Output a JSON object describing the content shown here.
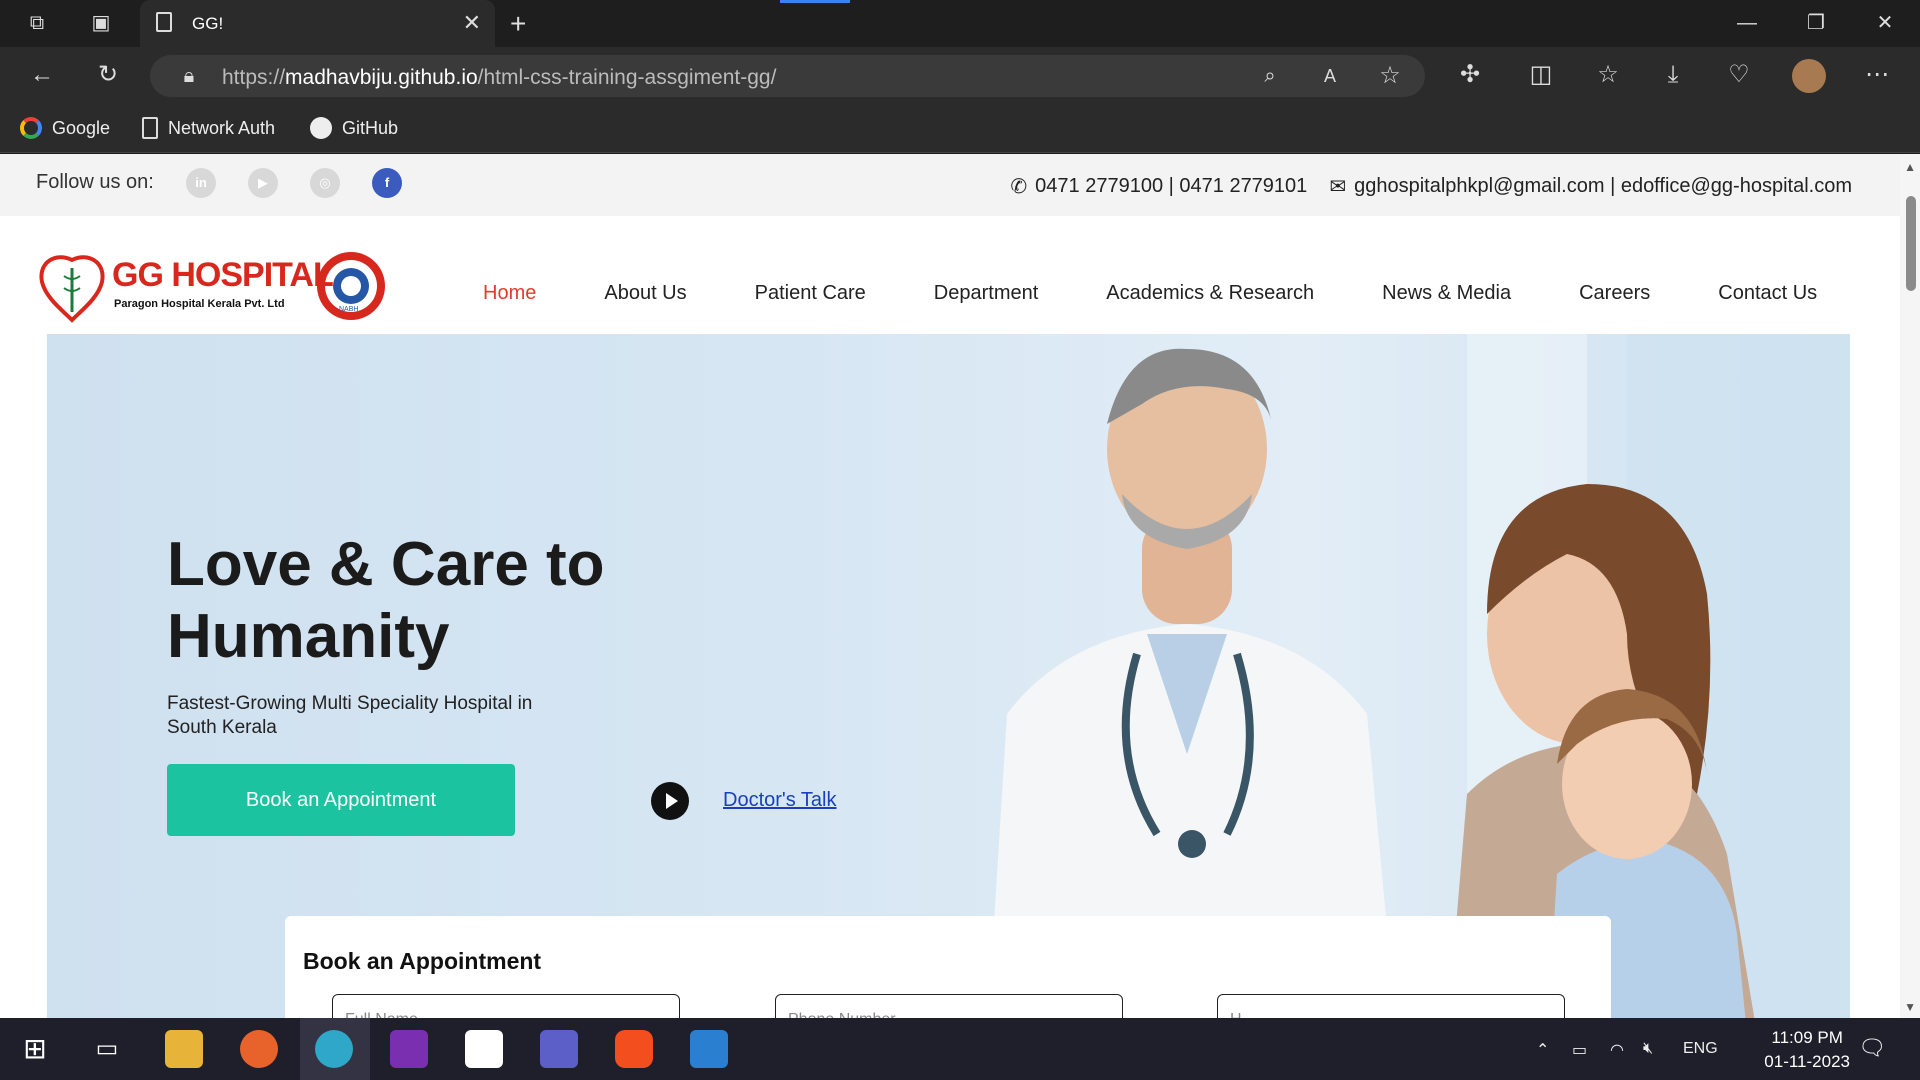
{
  "browser": {
    "tab_title": "GG!",
    "url_prefix": "https://",
    "url_host": "madhavbiju.github.io",
    "url_path": "/html-css-training-assgiment-gg/",
    "bookmarks": [
      {
        "label": "Google"
      },
      {
        "label": "Network Auth"
      },
      {
        "label": "GitHub"
      }
    ]
  },
  "topbar": {
    "follow_label": "Follow us on:",
    "social": [
      "in",
      "▶",
      "◎",
      "f"
    ],
    "phones": "0471 2779100 | 0471 2779101",
    "emails": "gghospitalphkpl@gmail.com | edoffice@gg-hospital.com"
  },
  "logo": {
    "name": "GG HOSPITAL",
    "tagline": "Paragon Hospital Kerala Pvt. Ltd",
    "badge": "NABH"
  },
  "nav": {
    "items": [
      {
        "label": "Home"
      },
      {
        "label": "About Us"
      },
      {
        "label": "Patient Care"
      },
      {
        "label": "Department"
      },
      {
        "label": "Academics & Research"
      },
      {
        "label": "News & Media"
      },
      {
        "label": "Careers"
      },
      {
        "label": "Contact Us"
      }
    ],
    "active_color": "#e23b2e"
  },
  "hero": {
    "title": "Love & Care to Humanity",
    "subtitle": "Fastest-Growing Multi Speciality Hospital in South Kerala",
    "cta": "Book an Appointment",
    "talk_link": "Doctor's Talk",
    "cta_color": "#1cc3a0"
  },
  "appointment": {
    "title": "Book an Appointment",
    "fields": [
      {
        "placeholder": "Full Name"
      },
      {
        "placeholder": "Phone Number"
      },
      {
        "placeholder": "H"
      }
    ]
  },
  "taskbar": {
    "lang": "ENG",
    "time": "11:09 PM",
    "date": "01-11-2023"
  }
}
